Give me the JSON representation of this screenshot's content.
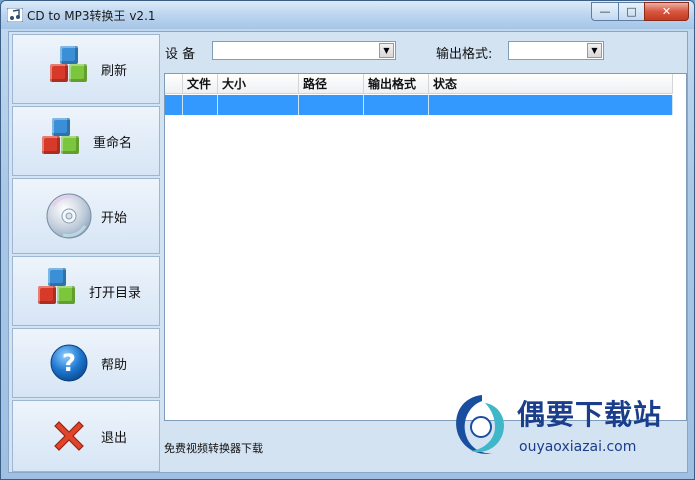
{
  "window": {
    "title": "CD to MP3转换王 v2.1",
    "min_label": "—",
    "max_label": "□",
    "close_label": "✕"
  },
  "sidebar": {
    "items": [
      {
        "label": "刷新",
        "icon": "cubes-icon"
      },
      {
        "label": "重命名",
        "icon": "cubes-icon"
      },
      {
        "label": "开始",
        "icon": "cd-disc-icon"
      },
      {
        "label": "打开目录",
        "icon": "cubes-icon"
      },
      {
        "label": "帮助",
        "icon": "help-icon"
      },
      {
        "label": "退出",
        "icon": "close-x-icon"
      }
    ]
  },
  "toolbar": {
    "device_label": "设 备",
    "device_value": "",
    "format_label": "输出格式:",
    "format_value": ""
  },
  "table": {
    "columns": [
      "",
      "文件",
      "大小",
      "路径",
      "输出格式",
      "状态"
    ]
  },
  "status": {
    "text": "免费视频转换器下载"
  },
  "watermark": {
    "name": "偶要下载站",
    "url": "ouyaoxiazai.com"
  },
  "colors": {
    "selection": "#3399ff",
    "accent": "#1a3e8c"
  }
}
